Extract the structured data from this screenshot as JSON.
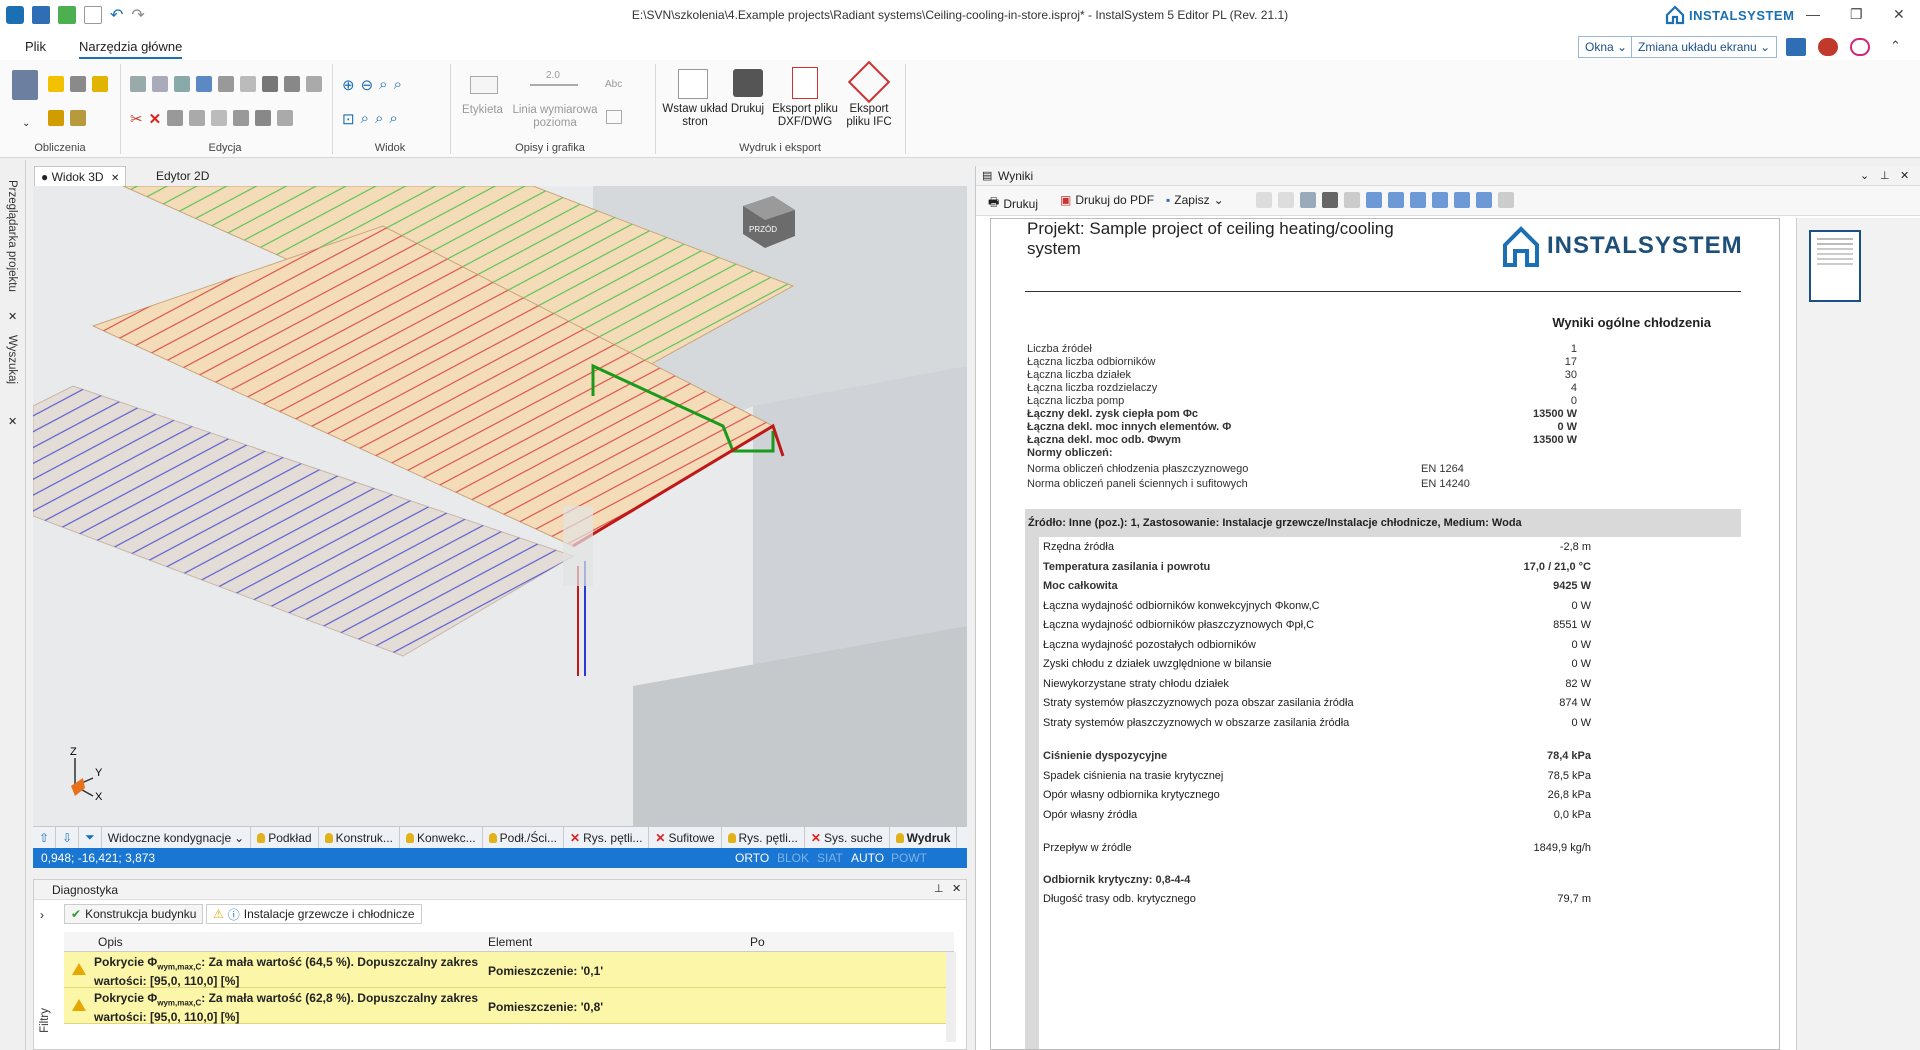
{
  "window": {
    "title": "E:\\SVN\\szkolenia\\4.Example projects\\Radiant systems\\Ceiling-cooling-in-store.isproj* - InstalSystem 5 Editor PL (Rev. 21.1)",
    "logo_text": "INSTALSYSTEM",
    "controls": [
      "—",
      "❐",
      "✕"
    ]
  },
  "menu": {
    "tabs": [
      "Plik",
      "Narzędzia główne"
    ],
    "right_buttons": [
      "Okna",
      "Zmiana układu ekranu"
    ]
  },
  "ribbon": {
    "groups": [
      "Obliczenia",
      "Edycja",
      "Widok",
      "Opisy i grafika",
      "Wydruk i eksport"
    ],
    "opisy": [
      "Etykieta",
      "Linia wymiarowa pozioma",
      "Abc"
    ],
    "wydruk": [
      "Wstaw układ stron",
      "Drukuj",
      "Eksport pliku DXF/DWG",
      "Eksport pliku IFC"
    ],
    "dim_value": "2.0"
  },
  "left_bar": [
    "Przeglądarka projektu",
    "Wyszukaj"
  ],
  "doc_tabs": [
    "● Widok 3D",
    "Edytor 2D"
  ],
  "viewport": {
    "cube_label": "PRZÓD",
    "axes": [
      "Z",
      "Y",
      "X"
    ]
  },
  "layers": {
    "visible_label": "Widoczne kondygnacje",
    "items": [
      {
        "label": "Podkład",
        "state": "bulb"
      },
      {
        "label": "Konstruk...",
        "state": "bulb"
      },
      {
        "label": "Konwekc...",
        "state": "bulb"
      },
      {
        "label": "Podł./Ści...",
        "state": "bulb"
      },
      {
        "label": "Rys. pętli...",
        "state": "x"
      },
      {
        "label": "Sufitowe",
        "state": "x"
      },
      {
        "label": "Rys. pętli...",
        "state": "bulb"
      },
      {
        "label": "Sys. suche",
        "state": "x"
      },
      {
        "label": "Wydruk",
        "state": "bulb"
      }
    ]
  },
  "status": {
    "coords": "0,948; -16,421; 3,873",
    "modes": [
      "ORTO",
      "BLOK",
      "SIAT",
      "AUTO",
      "POWT"
    ],
    "active_modes": [
      "ORTO",
      "AUTO"
    ]
  },
  "diagnostics": {
    "title": "Diagnostyka",
    "tabs": [
      "Konstrukcja budynku",
      "Instalacje grzewcze i chłodnicze"
    ],
    "filter_label": "Filtry",
    "columns": [
      "Opis",
      "Element",
      "Po"
    ],
    "rows": [
      {
        "desc_a": "Pokrycie Φ",
        "desc_sub": "wym,max,C",
        "desc_b": ": Za mała wartość (64,5 %). Dopuszczalny zakres wartości: [95,0, 110,0] [%]",
        "element": "Pomieszczenie: '0,1'"
      },
      {
        "desc_a": "Pokrycie Φ",
        "desc_sub": "wym,max,C",
        "desc_b": ": Za mała wartość (62,8 %). Dopuszczalny zakres wartości: [95,0, 110,0] [%]",
        "element": "Pomieszczenie: '0,8'"
      }
    ]
  },
  "results": {
    "panel_title": "Wyniki",
    "toolbar": [
      "Drukuj",
      "Drukuj do PDF",
      "Zapisz"
    ],
    "project_title": "Projekt: Sample project of ceiling heating/cooling system",
    "section_title": "Wyniki ogólne chłodzenia",
    "summary": [
      {
        "label": "Liczba źródeł",
        "value": "1",
        "bold": false
      },
      {
        "label": "Łączna liczba odbiorników",
        "value": "17",
        "bold": false
      },
      {
        "label": "Łączna liczba działek",
        "value": "30",
        "bold": false
      },
      {
        "label": "Łączna liczba rozdzielaczy",
        "value": "4",
        "bold": false
      },
      {
        "label": "Łączna liczba pomp",
        "value": "0",
        "bold": false
      },
      {
        "label": "Łączny dekl. zysk ciepła pom Φc",
        "value": "13500 W",
        "bold": true
      },
      {
        "label": "Łączna dekl. moc innych elementów. Φ",
        "value": "0 W",
        "bold": true
      },
      {
        "label": "Łączna dekl. moc odb. Φwym",
        "value": "13500 W",
        "bold": true
      }
    ],
    "norms_title": "Normy obliczeń:",
    "norms": [
      {
        "label": "Norma obliczeń chłodzenia płaszczyznowego",
        "value": "EN 1264"
      },
      {
        "label": "Norma obliczeń paneli ściennych i sufitowych",
        "value": "EN 14240"
      }
    ],
    "source_header": "Źródło: Inne (poz.): 1, Zastosowanie: Instalacje grzewcze/Instalacje chłodnicze, Medium: Woda",
    "source_rows": [
      {
        "label": "Rzędna źródła",
        "value": "-2,8 m",
        "bold": false
      },
      {
        "label": "Temperatura zasilania i powrotu",
        "value": "17,0 / 21,0 °C",
        "bold": true
      },
      {
        "label": "Moc całkowita",
        "value": "9425 W",
        "bold": true
      },
      {
        "label": "Łączna wydajność odbiorników konwekcyjnych Φkonw,C",
        "value": "0 W",
        "bold": false
      },
      {
        "label": "Łączna wydajność odbiorników płaszczyznowych Φpł,C",
        "value": "8551 W",
        "bold": false
      },
      {
        "label": "Łączna wydajność pozostałych odbiorników",
        "value": "0 W",
        "bold": false
      },
      {
        "label": "Zyski chłodu z działek uwzględnione w bilansie",
        "value": "0 W",
        "bold": false
      },
      {
        "label": "Niewykorzystane straty chłodu działek",
        "value": "82 W",
        "bold": false
      },
      {
        "label": "Straty systemów płaszczyznowych poza obszar zasilania źródła",
        "value": "874 W",
        "bold": false
      },
      {
        "label": "Straty systemów płaszczyznowych w obszarze zasilania źródła",
        "value": "0 W",
        "bold": false
      },
      {
        "label": "Ciśnienie dyspozycyjne",
        "value": "78,4 kPa",
        "bold": true
      },
      {
        "label": "Spadek ciśnienia na trasie krytycznej",
        "value": "78,5 kPa",
        "bold": false
      },
      {
        "label": "Opór własny odbiornika krytycznego",
        "value": "26,8 kPa",
        "bold": false
      },
      {
        "label": "Opór własny źródła",
        "value": "0,0 kPa",
        "bold": false
      },
      {
        "label": "Przepływ w źródle",
        "value": "1849,9 kg/h",
        "bold": false
      },
      {
        "label": "Odbiornik krytyczny: 0,8-4-4",
        "value": "",
        "bold": true
      },
      {
        "label": "Długość trasy odb. krytycznego",
        "value": "79,7 m",
        "bold": false
      }
    ]
  }
}
